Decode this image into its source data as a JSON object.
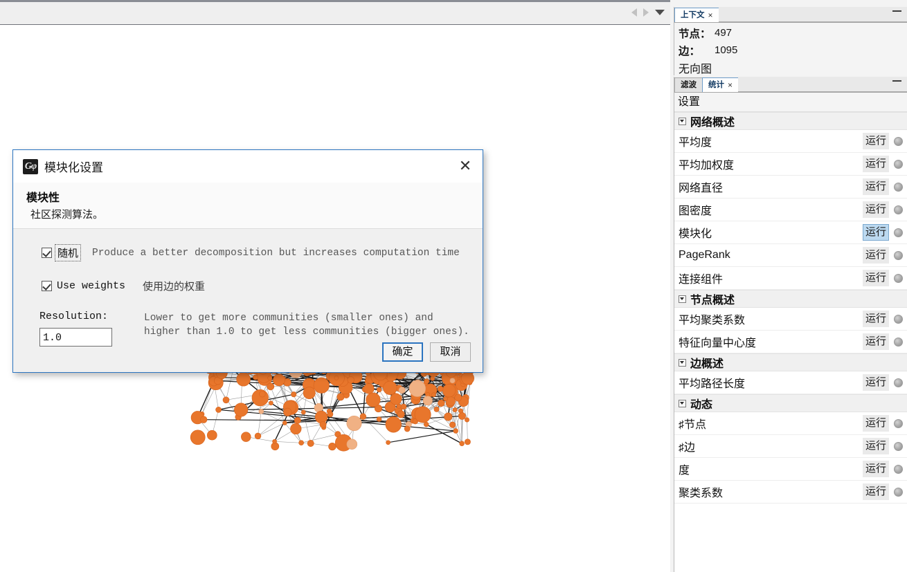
{
  "toolbar": {
    "nav_back_icon": "left-arrow-icon",
    "nav_forward_icon": "right-arrow-icon",
    "nav_dropdown_icon": "chevron-down-icon"
  },
  "context_panel": {
    "tab_label": "上下文",
    "tab_close": "×",
    "minimize_label": "",
    "rows": [
      {
        "key": "节点：",
        "value": "497"
      },
      {
        "key": "边：",
        "value": "1095"
      }
    ],
    "graph_type": "无向图"
  },
  "stats_panel": {
    "tabs": [
      {
        "label": "滤波",
        "active": false,
        "closable": false
      },
      {
        "label": "统计",
        "active": true,
        "closable": true,
        "close": "×"
      }
    ],
    "settings_title": "设置",
    "run_label": "运行",
    "groups": [
      {
        "title": "网络概述",
        "items": [
          {
            "label": "平均度",
            "selected": false
          },
          {
            "label": "平均加权度",
            "selected": false
          },
          {
            "label": "网络直径",
            "selected": false
          },
          {
            "label": "图密度",
            "selected": false
          },
          {
            "label": "模块化",
            "selected": true
          },
          {
            "label": "PageRank",
            "selected": false
          },
          {
            "label": "连接组件",
            "selected": false
          }
        ]
      },
      {
        "title": "节点概述",
        "items": [
          {
            "label": "平均聚类系数",
            "selected": false
          },
          {
            "label": "特征向量中心度",
            "selected": false
          }
        ]
      },
      {
        "title": "边概述",
        "items": [
          {
            "label": "平均路径长度",
            "selected": false
          }
        ]
      },
      {
        "title": "动态",
        "items": [
          {
            "label": "♯节点",
            "selected": false
          },
          {
            "label": "♯边",
            "selected": false
          },
          {
            "label": "度",
            "selected": false
          },
          {
            "label": "聚类系数",
            "selected": false
          }
        ]
      }
    ]
  },
  "annotation": {
    "shape": "red-ellipse-highlight",
    "color": "#e02020"
  },
  "dialog": {
    "logo_glyph": "Gφ",
    "title": "模块化设置",
    "close_icon": "✕",
    "heading": "模块性",
    "subheading": "社区探测算法。",
    "options": [
      {
        "label": "随机",
        "checked": true,
        "focused": true,
        "description": "Produce a better decomposition but increases computation time",
        "desc_lang": "en"
      },
      {
        "label": "Use weights",
        "checked": true,
        "focused": false,
        "description": "使用边的权重",
        "desc_lang": "cn"
      }
    ],
    "resolution_label": "Resolution:",
    "resolution_value": "1.0",
    "resolution_desc_line1": "Lower to get more communities (smaller ones) and",
    "resolution_desc_line2": "higher than 1.0 to get less communities (bigger ones).",
    "ok_label": "确定",
    "cancel_label": "取消"
  },
  "graph": {
    "node_color": "#e8762c",
    "node_color_light": "#f0a濃",
    "edge_color": "#8a8a8a",
    "background": "#ffffff"
  }
}
